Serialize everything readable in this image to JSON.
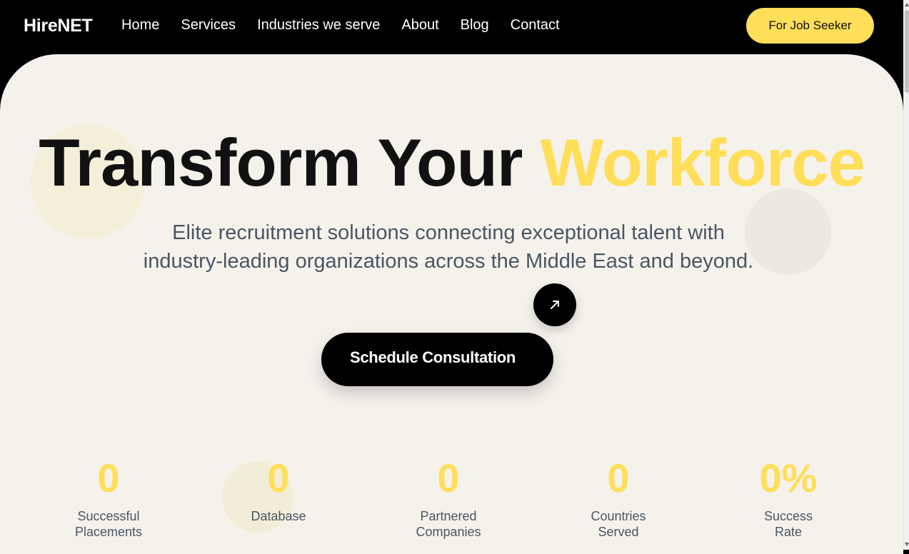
{
  "nav": {
    "brand": "HireNET",
    "links": [
      "Home",
      "Services",
      "Industries we serve",
      "About",
      "Blog",
      "Contact"
    ],
    "cta_label": "For Job Seeker"
  },
  "hero": {
    "headline_main": "Transform Your",
    "headline_accent": "Workforce",
    "subhead_line1": "Elite recruitment solutions connecting exceptional talent with",
    "subhead_line2": "industry-leading organizations across the Middle East and beyond.",
    "cta_label": "Schedule Consultation",
    "cta_icon": "arrow-up-right-icon"
  },
  "stats": [
    {
      "value": "0",
      "label": "Successful Placements"
    },
    {
      "value": "0",
      "label": "Database"
    },
    {
      "value": "0",
      "label": "Partnered Companies"
    },
    {
      "value": "0",
      "label": "Countries Served"
    },
    {
      "value": "0%",
      "label": "Success Rate"
    }
  ],
  "colors": {
    "accent": "#ffde59",
    "hero_background": "#f5f2ec",
    "nav_background": "#000000",
    "text_dark": "#111111",
    "text_muted": "#4b5563"
  }
}
